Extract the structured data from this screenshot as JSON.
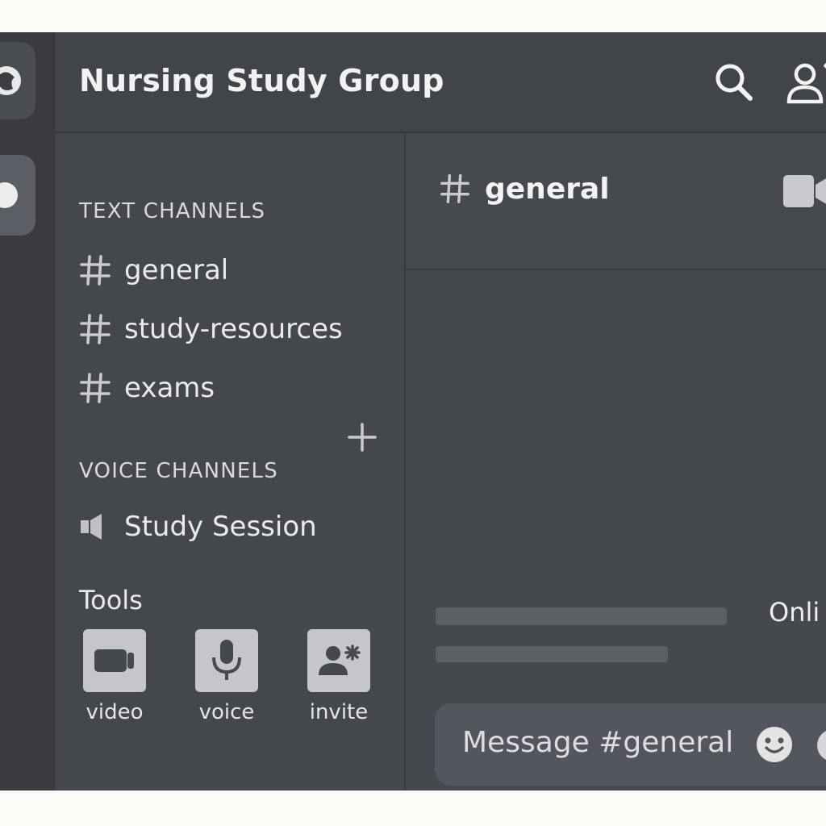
{
  "server": {
    "name": "Nursing Study Group"
  },
  "sidebar": {
    "text_category": "TEXT CHANNELS",
    "text_channels": [
      "general",
      "study-resources",
      "exams"
    ],
    "voice_category": "VOICE CHANNELS",
    "voice_channels": [
      "Study Session"
    ],
    "tools_label": "Tools",
    "tools": [
      {
        "label": "video",
        "icon": "video-camera-icon"
      },
      {
        "label": "voice",
        "icon": "microphone-icon"
      },
      {
        "label": "invite",
        "icon": "add-user-icon"
      }
    ]
  },
  "main": {
    "channel_name": "general",
    "online_label": "Onli",
    "composer_placeholder": "Message #general"
  },
  "colors": {
    "app_bg": "#43464b",
    "rail_bg": "#393b3f",
    "text": "#e6e7e9",
    "tile": "#c4c6c9"
  }
}
